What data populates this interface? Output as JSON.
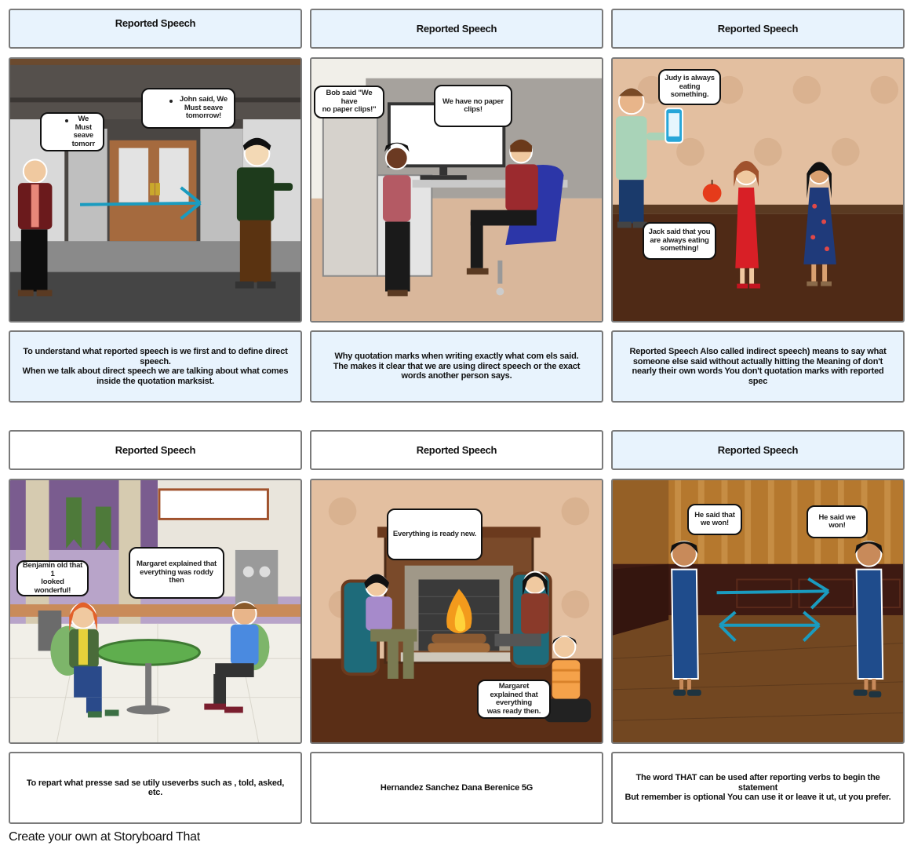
{
  "storyboard": {
    "panels": [
      {
        "title": "Reported Speech",
        "scene": "storefront with two men and a blue arrow",
        "bubbles": [
          "We\nMust\nseave\ntomorr",
          "John said,      We\nMust seave\ntomorrow!"
        ],
        "description": "To understand what reported speech is we first and to define direct speech.\nWhen we talk about direct speech we are talking about what comes inside the quotation marksist."
      },
      {
        "title": "Reported Speech",
        "scene": "office with woman standing and man seated at desk",
        "bubbles": [
          "Bob said \"We have\nno paper clips!\"",
          "We have no paper\nclips!"
        ],
        "description": "Why quotation marks when writing exactly what com els said.\nThe makes it clear that we are using direct speech or the exact words another person says."
      },
      {
        "title": "Reported Speech",
        "scene": "room with man holding phone and two women, one holding an apple",
        "bubbles": [
          "Judy is always\neating\nsomething.",
          "Jack said that you\nare always eating\nsomething!"
        ],
        "description": "Reported Speech Also called indirect speech) means to say what someone else said without actually hitting the Meaning of don't nearly their own words You don't quotation marks with reported spec"
      },
      {
        "title": "Reported Speech",
        "scene": "cafeteria with two students at a table",
        "bubbles": [
          "Benjamin old that 1\nlooked wonderful!",
          "Margaret explained that\neverything was roddy\nthen"
        ],
        "description": "To repart what presse sad se utily useverbs such as , told, asked, etc."
      },
      {
        "title": "Reported Speech",
        "scene": "living room with fireplace and three people",
        "bubbles": [
          "Everything is ready new.",
          "Margaret\nexplained that\neverything\nwas ready then."
        ],
        "description": "Hernandez Sanchez Dana Berenice 5G"
      },
      {
        "title": "Reported Speech",
        "scene": "wood-paneled room with two women in blue dresses and arrows",
        "bubbles": [
          "He said that\nwe won!",
          "He said we won!"
        ],
        "description": "The word THAT can be used after reporting verbs to begin the statement\nBut remember is optional You can use it or leave it ut, ut you prefer."
      }
    ]
  },
  "footer": {
    "text": "Create your own at Storyboard That"
  },
  "colors": {
    "cell_blue": "#e8f3fd",
    "cell_border": "#7a7a7a",
    "arrow": "#1a9bbf"
  }
}
